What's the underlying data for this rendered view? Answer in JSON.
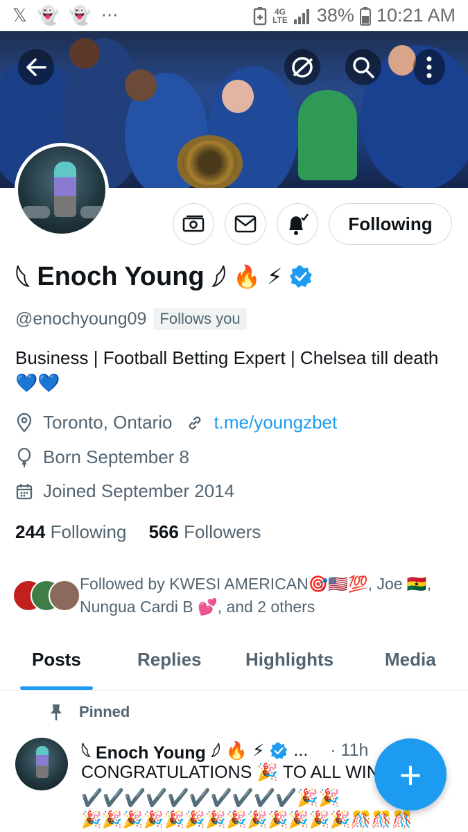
{
  "status_bar": {
    "left_icons": [
      "x-icon",
      "snapchat-icon",
      "snapchat-icon",
      "more-dots-icon"
    ],
    "lte_top": "4G",
    "lte_bottom": "LTE",
    "battery_percent": "38%",
    "time": "10:21 AM"
  },
  "header": {
    "back_icon": "back-arrow-icon",
    "grok_icon": "grok-icon",
    "search_icon": "search-icon",
    "more_icon": "more-vertical-icon"
  },
  "actions": {
    "tip_icon": "tip-money-icon",
    "message_icon": "message-icon",
    "notify_icon": "bell-notify-icon",
    "following_label": "Following"
  },
  "profile": {
    "name_prefix": "𓆩",
    "name": "Enoch Young",
    "name_suffix": "𓆪",
    "name_emojis": "🔥 ⚡",
    "handle": "@enochyoung09",
    "follows_you": "Follows you",
    "bio": "Business | Football Betting Expert | Chelsea till death 💙💙",
    "location": "Toronto, Ontario",
    "link": "t.me/youngzbet",
    "birthday": "Born September 8",
    "joined": "Joined September 2014",
    "following_count": "244",
    "following_label": "Following",
    "followers_count": "566",
    "followers_label": "Followers",
    "followed_by": "Followed by KWESI AMERICAN🎯🇺🇸💯, Joe 🇬🇭, Nungua Cardi B 💕, and 2 others"
  },
  "tabs": [
    "Posts",
    "Replies",
    "Highlights",
    "Media"
  ],
  "colors": {
    "accent": "#1d9bf0",
    "text": "#0f1419",
    "muted": "#536471"
  },
  "pinned_post": {
    "pinned_label": "Pinned",
    "author": "𓆩 Enoch Young 𓆪",
    "author_emojis": "🔥 ⚡",
    "ellipsis": "...",
    "time": "· 11h",
    "text": "CONGRATULATIONS 🎉 TO ALL WINNERS✔️✔️✔️✔️✔️✔️✔️✔️✔️✔️🎉🎉",
    "emoji_line": "🎉🎉🎉🎉🎉🎉🎉🎉🎉🎉🎉🎉🎉🎊🎊🎊"
  },
  "fab_label": "+"
}
